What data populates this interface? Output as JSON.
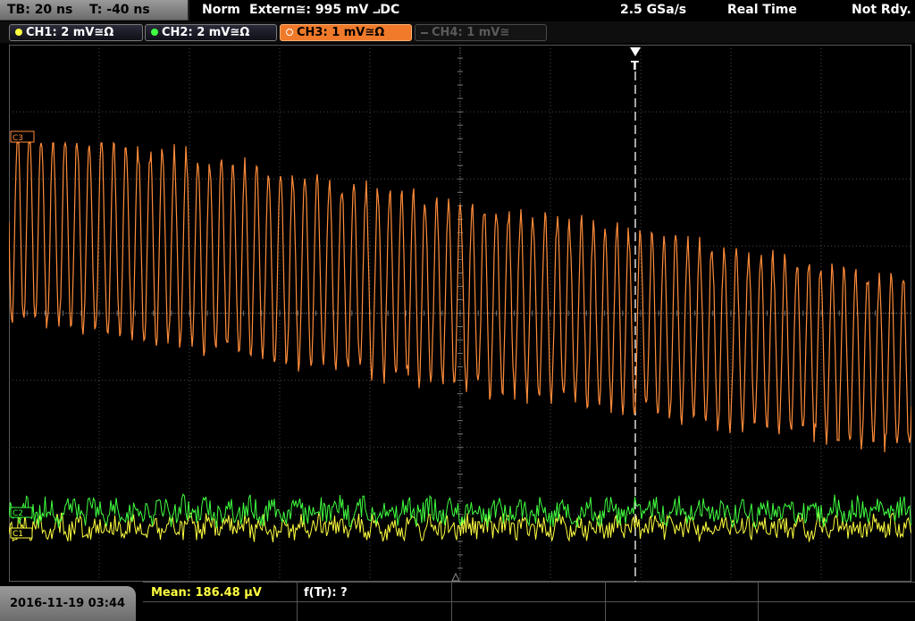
{
  "timebase": {
    "tb": "TB: 20 ns",
    "t": "T: -40 ns"
  },
  "status": {
    "mode": "Norm",
    "trigger": "Extern≅: 995 mV ⨼DC",
    "rate": "2.5 GSa/s",
    "acq": "Real Time",
    "state": "Not Rdy."
  },
  "channels": [
    {
      "label": "CH1: 2 mV≅Ω",
      "color": "#ffff40"
    },
    {
      "label": "CH2: 2 mV≅Ω",
      "color": "#40ff40"
    },
    {
      "label": "CH3: 1 mV≅Ω",
      "color": "#ff8c3a"
    },
    {
      "label": "CH4: 1 mV≅",
      "color": "#606060"
    }
  ],
  "markers": {
    "c3": "C3",
    "c2": "C2",
    "c1": "C1",
    "trigger": "T"
  },
  "footer": {
    "datetime": "2016-11-19 03:44",
    "mean": "Mean: 186.48 µV",
    "freq": "f(Tr): ?"
  },
  "colors": {
    "grid": "#4a4a4a",
    "trigger_line": "#ffffff"
  }
}
